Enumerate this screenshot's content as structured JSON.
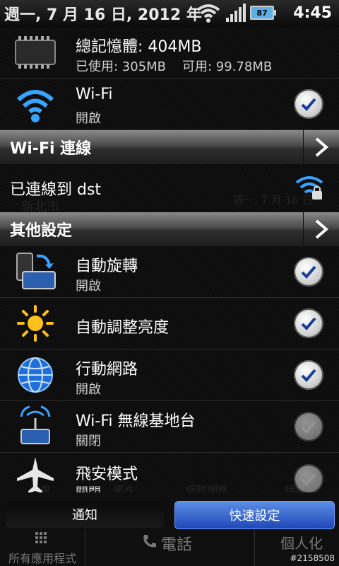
{
  "status_bar": {
    "date": "週一, 7 月 16 日, 2012 年",
    "time": "4:45",
    "battery": "87"
  },
  "memory": {
    "title": "總記憶體: 404MB",
    "used": "已使用: 305MB",
    "free": "可用: 99.78MB"
  },
  "wifi": {
    "title": "Wi-Fi",
    "status": "開啟",
    "checked": true
  },
  "wifi_section": {
    "label": "Wi-Fi 連線"
  },
  "connected": {
    "text": "已連線到 dst"
  },
  "other_section": {
    "label": "其他設定"
  },
  "settings": [
    {
      "title": "自動旋轉",
      "status": "開啟",
      "checked": true
    },
    {
      "title": "自動調整亮度",
      "status": "",
      "checked": true
    },
    {
      "title": "行動網路",
      "status": "開啟",
      "checked": true
    },
    {
      "title": "Wi-Fi 無線基地台",
      "status": "關閉",
      "checked": false
    },
    {
      "title": "飛安模式",
      "status": "關閉",
      "checked": false
    }
  ],
  "buttons": {
    "notify": "通知",
    "quick": "快速設定"
  },
  "dock": {
    "all_apps": "所有應用程式",
    "phone": "電話",
    "personalize": "個人化"
  },
  "background_ghost": {
    "city": "新北市",
    "date": "週一, 7 月 16 日",
    "labels": [
      "訊息",
      "郵件",
      "網際網路",
      "相機"
    ]
  },
  "watermark": "#2158508",
  "colors": {
    "accent": "#1a4fb8",
    "check_mark": "#1a3f99",
    "panel": "#0f0f0f"
  }
}
